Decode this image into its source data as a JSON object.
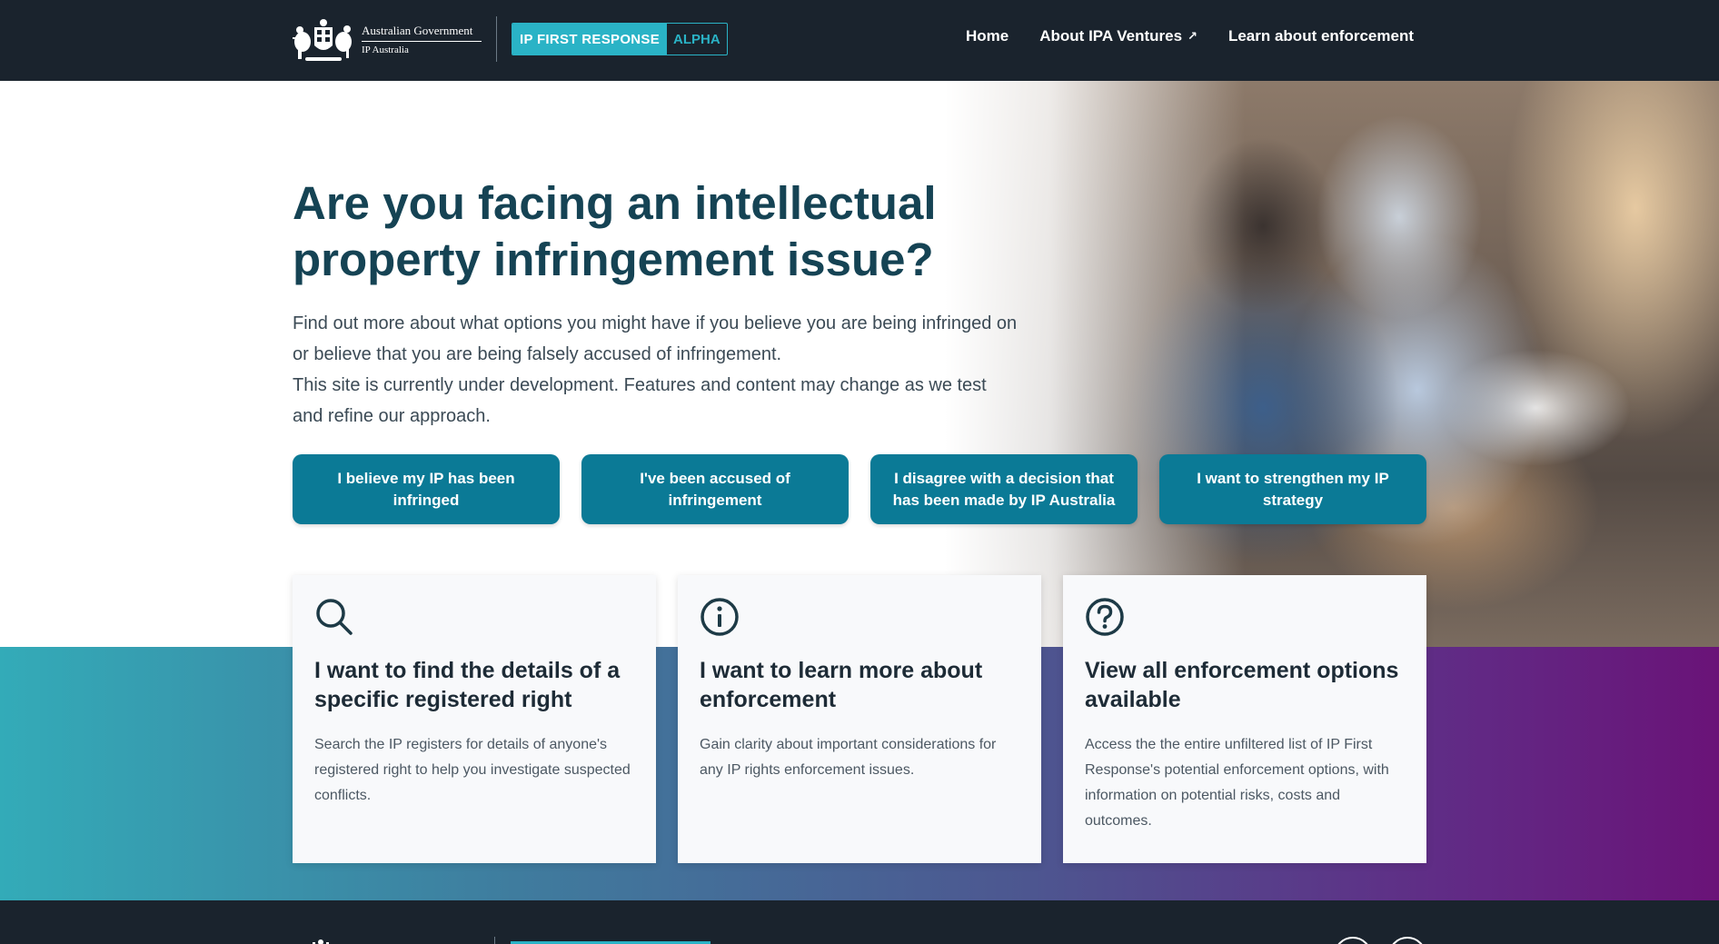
{
  "header": {
    "gov_line1": "Australian Government",
    "gov_line2": "IP Australia",
    "product_name": "IP FIRST RESPONSE",
    "product_stage": "ALPHA",
    "nav": [
      {
        "label": "Home"
      },
      {
        "label": "About IPA Ventures",
        "icon": "external-link-icon",
        "icon_glyph": "↗"
      },
      {
        "label": "Learn about enforcement"
      }
    ]
  },
  "hero": {
    "title": "Are you facing an intellectual property infringement issue?",
    "desc_line1": "Find out more about what options you might have if you believe you are being infringed on or believe that you are being falsely accused of infringement.",
    "desc_line2": "This site is currently under development. Features and content may change as we test and refine our approach.",
    "buttons": [
      {
        "label": "I believe my IP has been infringed"
      },
      {
        "label": "I've been accused of infringement"
      },
      {
        "label": "I disagree with a decision that has been made by IP Australia"
      },
      {
        "label": "I want to strengthen my IP strategy"
      }
    ]
  },
  "cards": [
    {
      "icon": "search-icon",
      "title": "I want to find the details of a specific registered right",
      "text": "Search the IP registers for details of anyone's registered right to help you investigate suspected conflicts."
    },
    {
      "icon": "info-icon",
      "title": "I want to learn more about enforcement",
      "text": "Gain clarity about important considerations for any IP rights enforcement issues."
    },
    {
      "icon": "help-icon",
      "title": "View all enforcement options available",
      "text": "Access the the entire unfiltered list of IP First Response's potential enforcement options, with information on potential risks, costs and outcomes."
    }
  ],
  "colors": {
    "header_bg": "#1a232d",
    "accent": "#2ab3c6",
    "button": "#0b7a96",
    "title": "#154354",
    "band_start": "#33abb8",
    "band_end": "#6a1378"
  }
}
